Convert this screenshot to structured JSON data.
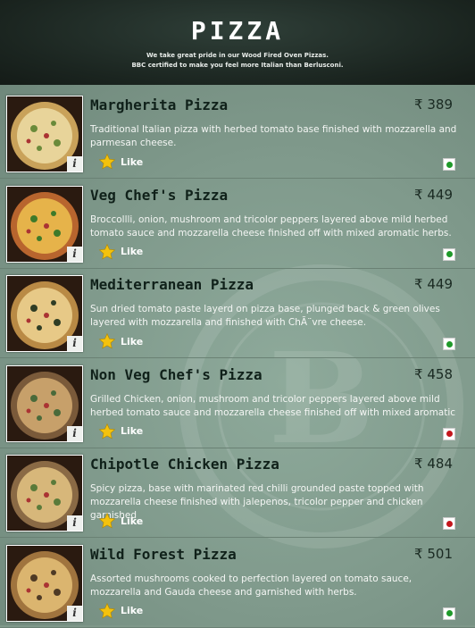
{
  "header": {
    "title": "PIZZA",
    "tagline1": "We take great pride in our Wood Fired Oven Pizzas.",
    "tagline2": "BBC certified to make you feel more Italian than Berlusconi."
  },
  "like_label": "Like",
  "currency": "₹",
  "items": [
    {
      "name": "Margherita Pizza",
      "price": "₹ 389",
      "desc": "Traditional Italian pizza with herbed tomato base finished with mozzarella and parmesan cheese.",
      "veg": true
    },
    {
      "name": "Veg Chef's Pizza",
      "price": "₹ 449",
      "desc": "Broccollli, onion, mushroom and tricolor peppers layered above mild herbed tomato sauce and mozzarella cheese finished off with mixed aromatic herbs.",
      "veg": true
    },
    {
      "name": "Mediterranean Pizza",
      "price": "₹ 449",
      "desc": "Sun dried tomato paste layerd on pizza base, plunged back  & green olives layered with mozzarella and finished with ChÃ¨vre cheese.",
      "veg": true
    },
    {
      "name": "Non Veg Chef's Pizza",
      "price": "₹ 458",
      "desc": "Grilled Chicken, onion, mushroom and tricolor peppers layered above mild herbed tomato sauce and mozzarella cheese finished off with mixed aromatic",
      "veg": false
    },
    {
      "name": "Chipotle Chicken Pizza",
      "price": "₹ 484",
      "desc": "Spicy pizza, base with marinated red chilli grounded paste topped with mozzarella cheese finished with jalepenos, tricolor pepper and chicken garnished",
      "veg": false
    },
    {
      "name": "Wild Forest Pizza",
      "price": "₹ 501",
      "desc": "Assorted mushrooms cooked to perfection layered on tomato sauce, mozzarella and Gauda cheese and garnished with herbs.",
      "veg": true
    }
  ],
  "colors": {
    "veg": "#1f9a2a",
    "nonveg": "#c4161c",
    "star": "#f4c20d"
  }
}
